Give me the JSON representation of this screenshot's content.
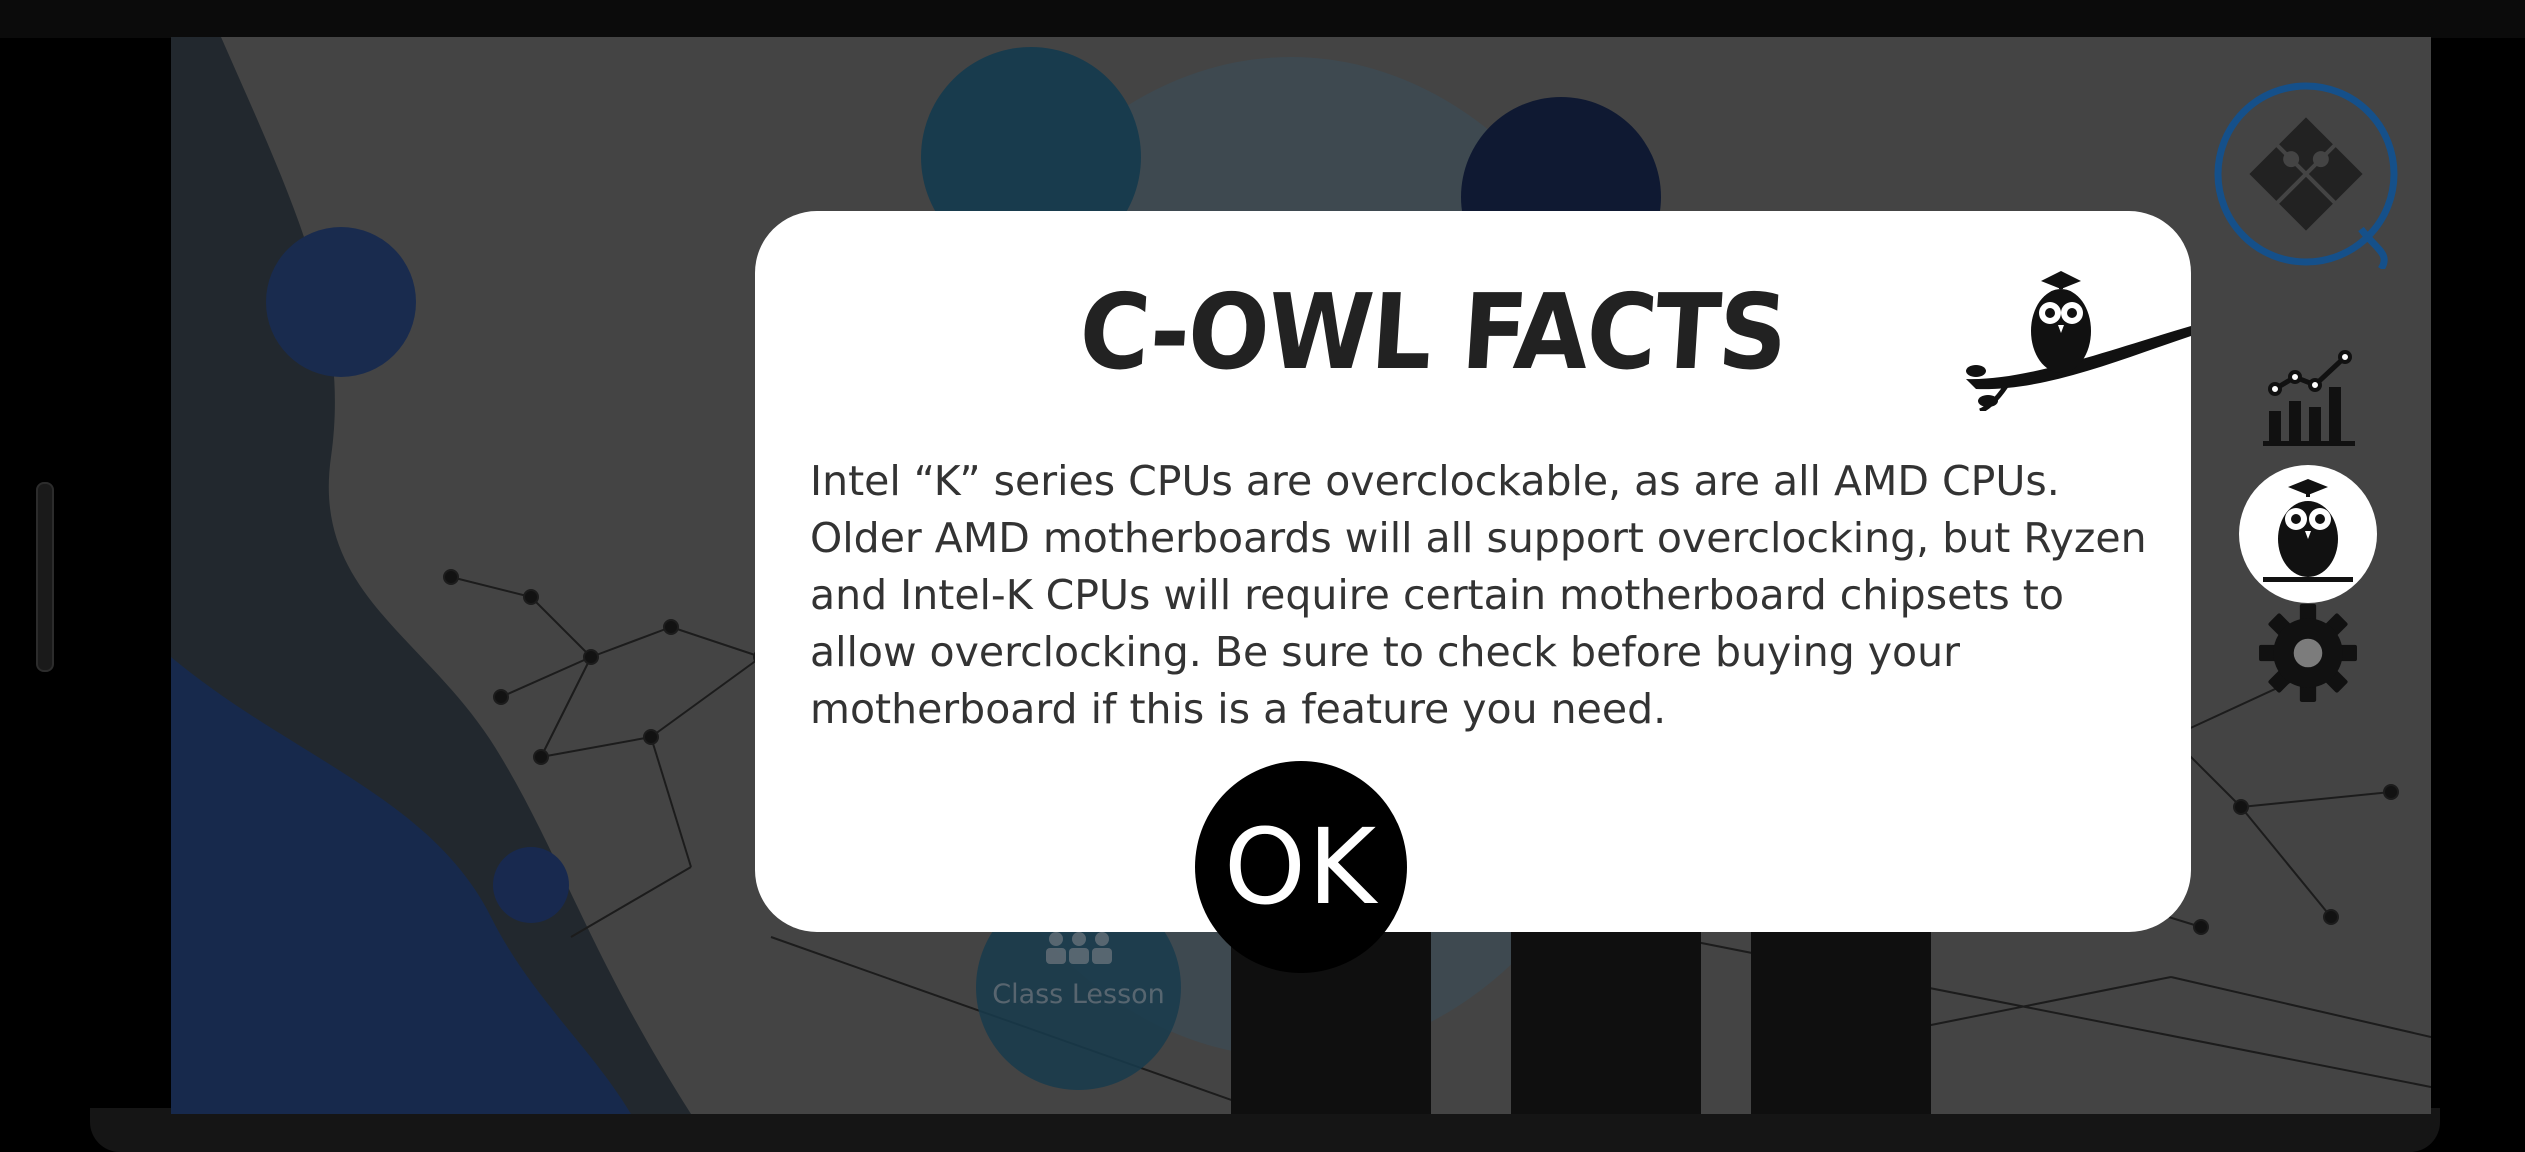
{
  "app": {
    "screen_background": "#7c7c7c",
    "accent_blue": "#15508a"
  },
  "background": {
    "class_lesson_label": "Class Lesson"
  },
  "sidebar": {
    "logo_icon": "puzzle-logo-icon",
    "items": [
      {
        "icon": "bar-chart-icon"
      },
      {
        "icon": "owl-icon",
        "active": true
      },
      {
        "icon": "gear-icon"
      }
    ]
  },
  "dialog": {
    "title": "C-OWL FACTS",
    "body": "Intel “K” series CPUs are overclockable, as are all AMD CPUs. Older AMD motherboards will all support overclocking, but Ryzen and Intel-K CPUs will require certain motherboard chipsets to allow overclocking. Be sure to check before buying your motherboard if this is a feature you need.",
    "ok_label": "OK"
  }
}
